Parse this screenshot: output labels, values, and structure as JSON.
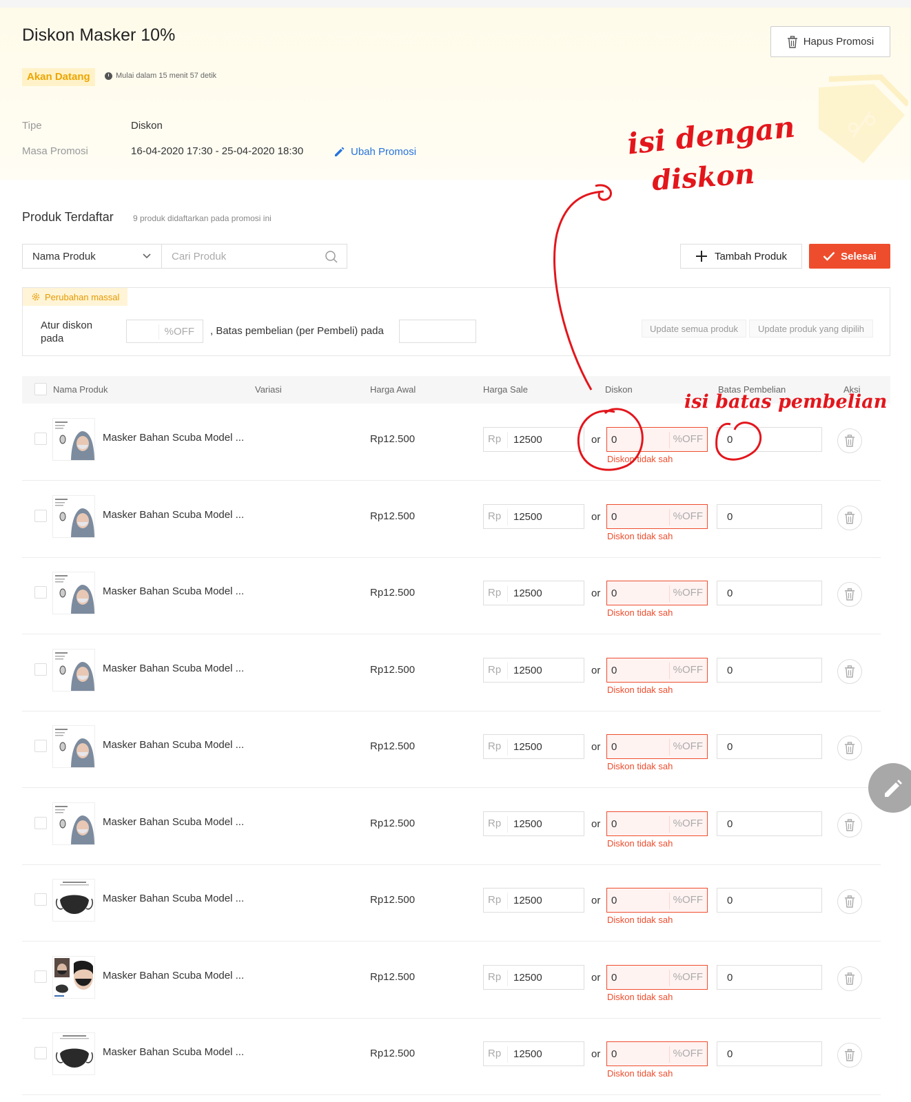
{
  "promo": {
    "title": "Diskon Masker 10%",
    "status": "Akan Datang",
    "countdown": "Mulai dalam 15 menit 57 detik",
    "type_label": "Tipe",
    "type_value": "Diskon",
    "period_label": "Masa Promosi",
    "period_value": "16-04-2020 17:30 - 25-04-2020 18:30",
    "edit_label": "Ubah Promosi",
    "delete_label": "Hapus Promosi"
  },
  "products_section": {
    "title": "Produk Terdaftar",
    "subtitle": "9 produk didaftarkan pada promosi ini",
    "filter_value": "Nama Produk",
    "search_placeholder": "Cari Produk",
    "add_label": "Tambah Produk",
    "done_label": "Selesai"
  },
  "mass_edit": {
    "tag": "Perubahan massal",
    "label": "Atur diskon pada",
    "pct_suffix": "%OFF",
    "limit_text": ", Batas pembelian (per Pembeli) pada",
    "update_all": "Update semua produk",
    "update_selected": "Update produk yang dipilih"
  },
  "table": {
    "headers": {
      "name": "Nama Produk",
      "variation": "Variasi",
      "orig_price": "Harga Awal",
      "sale_price": "Harga Sale",
      "discount": "Diskon",
      "limit": "Batas Pembelian",
      "action": "Aksi"
    },
    "currency_prefix": "Rp",
    "or_text": "or",
    "pct_suffix": "%OFF",
    "error_text": "Diskon tidak sah",
    "rows": [
      {
        "name": "Masker Bahan Scuba Model ...",
        "orig_price": "Rp12.500",
        "sale_price": "12500",
        "discount": "0",
        "limit": "0"
      },
      {
        "name": "Masker Bahan Scuba Model ...",
        "orig_price": "Rp12.500",
        "sale_price": "12500",
        "discount": "0",
        "limit": "0"
      },
      {
        "name": "Masker Bahan Scuba Model ...",
        "orig_price": "Rp12.500",
        "sale_price": "12500",
        "discount": "0",
        "limit": "0"
      },
      {
        "name": "Masker Bahan Scuba Model ...",
        "orig_price": "Rp12.500",
        "sale_price": "12500",
        "discount": "0",
        "limit": "0"
      },
      {
        "name": "Masker Bahan Scuba Model ...",
        "orig_price": "Rp12.500",
        "sale_price": "12500",
        "discount": "0",
        "limit": "0"
      },
      {
        "name": "Masker Bahan Scuba Model ...",
        "orig_price": "Rp12.500",
        "sale_price": "12500",
        "discount": "0",
        "limit": "0"
      },
      {
        "name": "Masker Bahan Scuba Model ...",
        "orig_price": "Rp12.500",
        "sale_price": "12500",
        "discount": "0",
        "limit": "0"
      },
      {
        "name": "Masker Bahan Scuba Model ...",
        "orig_price": "Rp12.500",
        "sale_price": "12500",
        "discount": "0",
        "limit": "0"
      },
      {
        "name": "Masker Bahan Scuba Model ...",
        "orig_price": "Rp12.500",
        "sale_price": "12500",
        "discount": "0",
        "limit": "0"
      }
    ]
  },
  "annotations": {
    "discount_note_1": "isi dengan",
    "discount_note_2": "diskon",
    "limit_note": "isi batas pembelian"
  },
  "icons": {
    "delete": "trash-icon",
    "edit": "pencil-icon",
    "search": "search-icon",
    "add": "plus-icon",
    "done": "check-icon",
    "mass": "gear-icon",
    "clock": "clock-icon",
    "fab": "pencil-icon"
  },
  "colors": {
    "accent": "#ee4d2d",
    "status": "#eda500",
    "link": "#2673dd",
    "annotation": "#e3161c"
  }
}
